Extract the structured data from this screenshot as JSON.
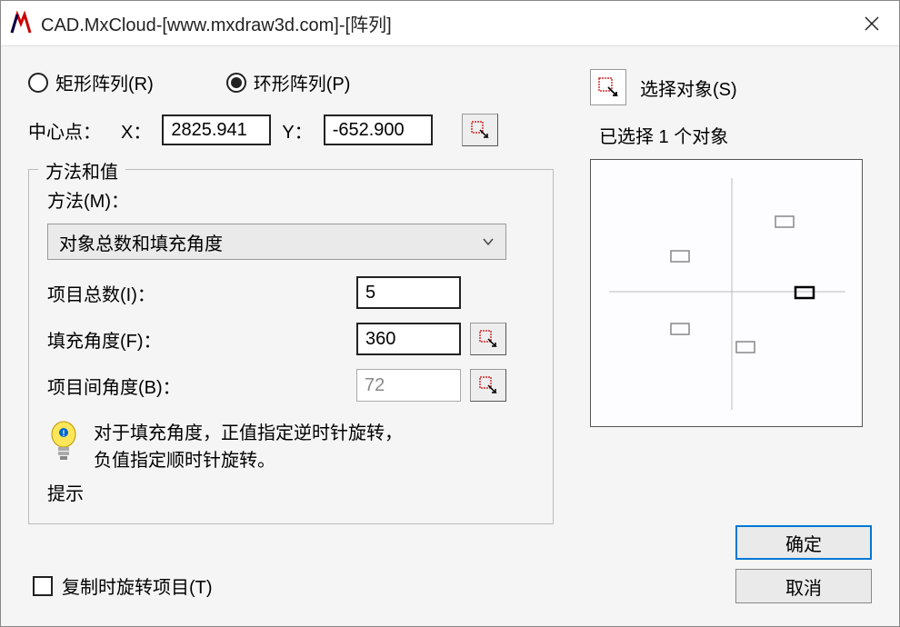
{
  "titlebar": {
    "title": "CAD.MxCloud-[www.mxdraw3d.com]-[阵列]"
  },
  "arrayType": {
    "rect_label": "矩形阵列(R)",
    "polar_label": "环形阵列(P)",
    "selected": "polar"
  },
  "centerPoint": {
    "label": "中心点：",
    "x_label": "X：",
    "x_value": "2825.941",
    "y_label": "Y：",
    "y_value": "-652.900"
  },
  "methodBox": {
    "group_title": "方法和值",
    "method_label": "方法(M)：",
    "method_value": "对象总数和填充角度",
    "total_label": "项目总数(I)：",
    "total_value": "5",
    "fillAngle_label": "填充角度(F)：",
    "fillAngle_value": "360",
    "itemAngle_label": "项目间角度(B)：",
    "itemAngle_value": "72",
    "hint_text_line1": "对于填充角度，正值指定逆时针旋转，",
    "hint_text_line2": "负值指定顺时针旋转。",
    "hint_label": "提示"
  },
  "selection": {
    "select_label": "选择对象(S)",
    "selected_text": "已选择 1 个对象"
  },
  "rotateCopy": {
    "label": "复制时旋转项目(T)",
    "checked": false
  },
  "buttons": {
    "ok_label": "确定",
    "cancel_label": "取消"
  }
}
